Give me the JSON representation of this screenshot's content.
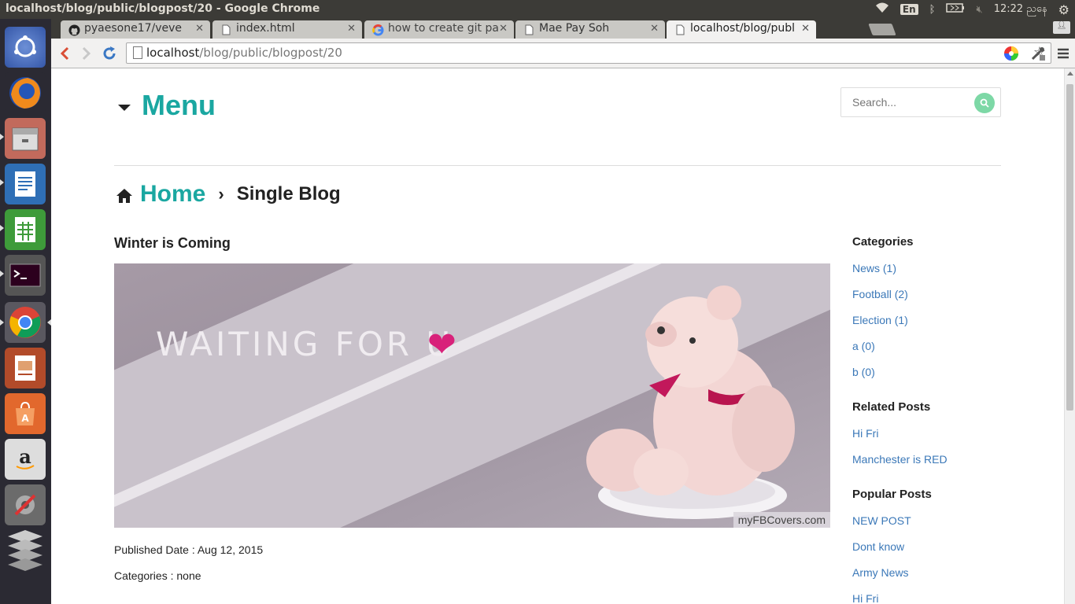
{
  "window": {
    "title": "localhost/blog/public/blogpost/20 - Google Chrome",
    "tray": {
      "lang": "En",
      "time": "12:22",
      "locale": "ညနေ"
    }
  },
  "launcher": {
    "items": [
      "ubuntu-dash",
      "firefox",
      "files",
      "libreoffice-writer",
      "libreoffice-calc",
      "terminal",
      "chrome",
      "libreoffice-impress",
      "software-center",
      "amazon",
      "system-settings",
      "workspaces"
    ]
  },
  "browser": {
    "tabs": [
      {
        "label": "pyaesone17/veve",
        "icon": "github-icon"
      },
      {
        "label": "index.html",
        "icon": "page-icon"
      },
      {
        "label": "how to create git pa",
        "icon": "google-icon"
      },
      {
        "label": "Mae Pay Soh",
        "icon": "page-icon"
      },
      {
        "label": "localhost/blog/publ",
        "icon": "page-icon",
        "active": true
      }
    ],
    "url_host": "localhost",
    "url_path": "/blog/public/blogpost/20"
  },
  "page": {
    "menu_label": "Menu",
    "search_placeholder": "Search...",
    "breadcrumb": {
      "home": "Home",
      "separator": "›",
      "current": "Single Blog"
    },
    "post": {
      "title": "Winter is Coming",
      "image_text": "WAITING FOR U",
      "image_watermark": "myFBCovers.com",
      "published": "Published Date : Aug 12, 2015",
      "categories": "Categories : none"
    },
    "sidebar": {
      "categories_title": "Categories",
      "categories": [
        "News (1)",
        "Football (2)",
        "Election (1)",
        "a (0)",
        "b (0)"
      ],
      "related_title": "Related Posts",
      "related": [
        "Hi Fri",
        "Manchester is RED"
      ],
      "popular_title": "Popular Posts",
      "popular": [
        "NEW POST",
        "Dont know",
        "Army News",
        "Hi Fri"
      ]
    }
  },
  "colors": {
    "accent": "#1aa7a1",
    "link": "#3b78b8",
    "heart": "#d8217a",
    "search_button": "#7dd8a6"
  }
}
